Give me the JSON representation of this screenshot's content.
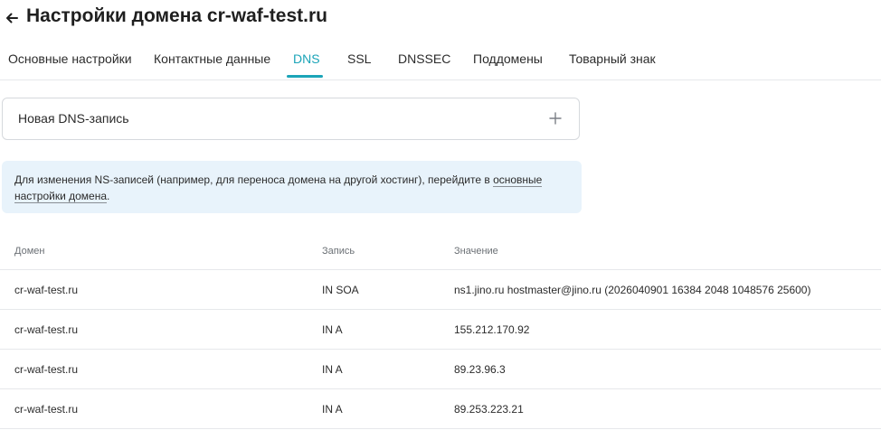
{
  "header": {
    "title": "Настройки домена cr-waf-test.ru",
    "back_icon": "arrow-left-icon"
  },
  "tabs": [
    {
      "label": "Основные настройки",
      "active": false
    },
    {
      "label": "Контактные данные",
      "active": false
    },
    {
      "label": "DNS",
      "active": true
    },
    {
      "label": "SSL",
      "active": false
    },
    {
      "label": "DNSSEC",
      "active": false
    },
    {
      "label": "Поддомены",
      "active": false
    },
    {
      "label": "Товарный знак",
      "active": false
    }
  ],
  "new_record": {
    "label": "Новая DNS-запись",
    "icon": "plus-icon"
  },
  "notice": {
    "text": "Для изменения NS-записей (например, для переноса домена на другой хостинг), перейдите в ",
    "link": "основные настройки домена",
    "suffix": "."
  },
  "table": {
    "headers": [
      "Домен",
      "Запись",
      "Значение"
    ],
    "rows": [
      {
        "domain": "cr-waf-test.ru",
        "record": "IN SOA",
        "value": "ns1.jino.ru hostmaster@jino.ru (2026040901 16384 2048 1048576 25600)"
      },
      {
        "domain": "cr-waf-test.ru",
        "record": "IN A",
        "value": "155.212.170.92"
      },
      {
        "domain": "cr-waf-test.ru",
        "record": "IN A",
        "value": "89.23.96.3"
      },
      {
        "domain": "cr-waf-test.ru",
        "record": "IN A",
        "value": "89.253.223.21"
      }
    ]
  },
  "colors": {
    "accent": "#1ba4b8",
    "notice_bg": "#e8f3fb",
    "border": "#e6e8eb"
  }
}
